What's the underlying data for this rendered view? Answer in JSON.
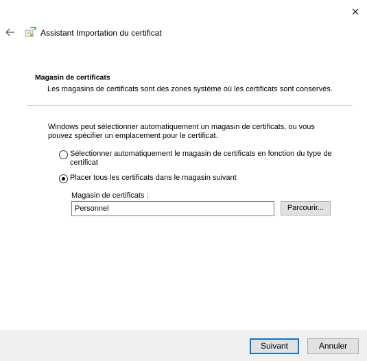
{
  "window": {
    "title": "Assistant Importation du certificat"
  },
  "header": {
    "heading": "Magasin de certificats",
    "description": "Les magasins de certificats sont des zones système où les certificats sont conservés."
  },
  "body": {
    "intro": "Windows peut sélectionner automatiquement un magasin de certificats, ou vous pouvez spécifier un emplacement pour le certificat.",
    "options": [
      {
        "label": "Sélectionner automatiquement le magasin de certificats en fonction du type de certificat",
        "selected": false
      },
      {
        "label": "Placer tous les certificats dans le magasin suivant",
        "selected": true
      }
    ],
    "store_label": "Magasin de certificats :",
    "store_value": "Personnel",
    "browse_label": "Parcourir..."
  },
  "footer": {
    "next_label": "Suivant",
    "cancel_label": "Annuler"
  },
  "icons": {
    "close": "close-icon",
    "back": "back-arrow-icon",
    "wizard": "certificate-wizard-icon"
  },
  "colors": {
    "accent": "#0078d7",
    "footer_bg": "#f0f0f0",
    "button_bg": "#e1e1e1"
  }
}
